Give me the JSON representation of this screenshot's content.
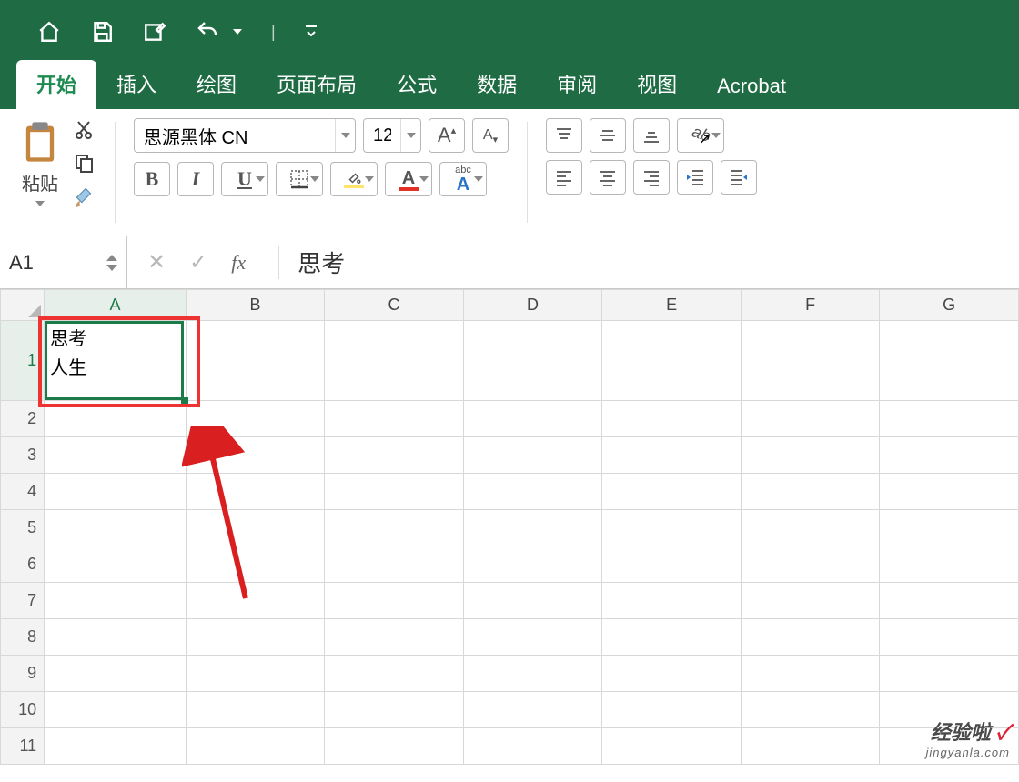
{
  "qat": {
    "home_icon": "home-icon",
    "save_icon": "save-icon",
    "edit_icon": "edit-icon",
    "undo_icon": "undo-icon"
  },
  "tabs": {
    "items": [
      "开始",
      "插入",
      "绘图",
      "页面布局",
      "公式",
      "数据",
      "审阅",
      "视图",
      "Acrobat"
    ],
    "active_index": 0
  },
  "ribbon": {
    "paste_label": "粘贴",
    "font_name": "思源黑体 CN",
    "font_size": "12",
    "bold": "B",
    "italic": "I",
    "underline": "U",
    "phonetic": "abc",
    "fill_color": "#ffe36b",
    "font_color": "#e33125"
  },
  "formula_bar": {
    "name_box": "A1",
    "fx_label": "fx",
    "value": "思考"
  },
  "grid": {
    "columns": [
      "A",
      "B",
      "C",
      "D",
      "E",
      "F",
      "G"
    ],
    "rows": [
      "1",
      "2",
      "3",
      "4",
      "5",
      "6",
      "7",
      "8",
      "9",
      "10",
      "11"
    ],
    "active_col": 0,
    "active_row": 0,
    "cells": {
      "A1_line1": "思考",
      "A1_line2": "人生"
    }
  },
  "watermark": {
    "brand": "经验啦",
    "check": "✓",
    "url": "jingyanla.com"
  }
}
